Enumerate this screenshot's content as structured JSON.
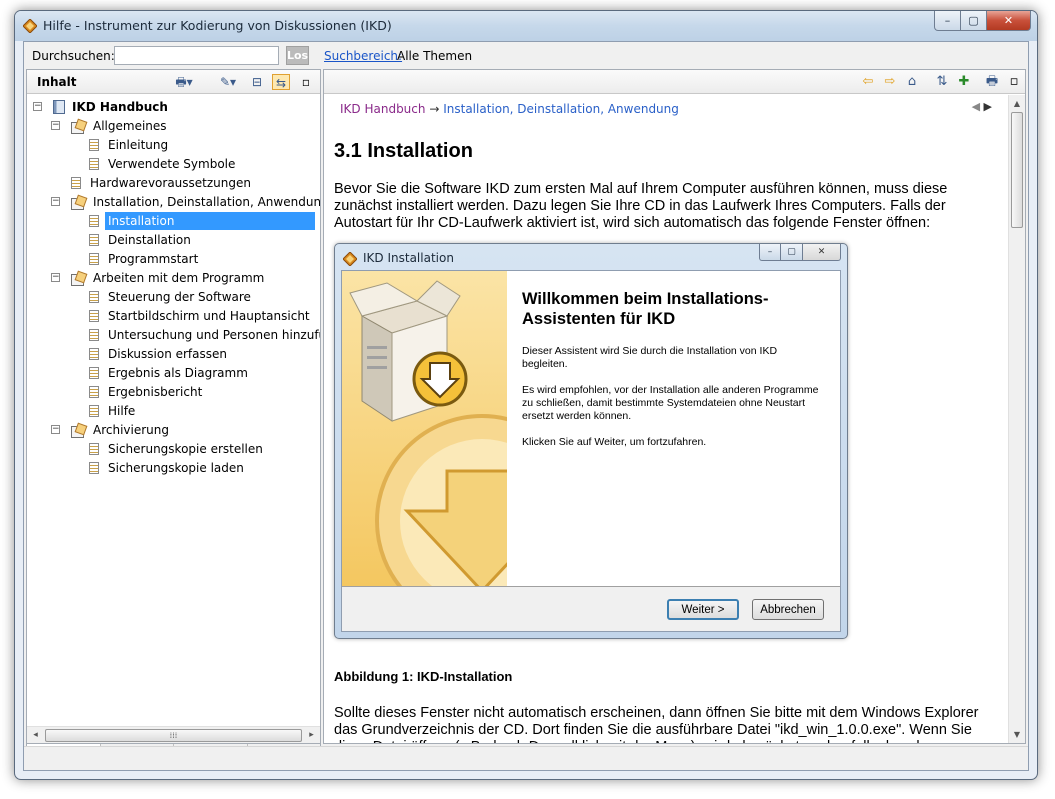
{
  "window": {
    "title": "Hilfe - Instrument zur Kodierung von Diskussionen (IKD)",
    "controls": {
      "minimize": "–",
      "maximize": "▢",
      "close": "✕"
    }
  },
  "search": {
    "label": "Durchsuchen:",
    "value": "",
    "go_label": "Los",
    "scope_link": "Suchbereich:",
    "scope_value": "Alle Themen"
  },
  "left_pane": {
    "title": "Inhalt",
    "toolbar_icons": [
      "print-icon",
      "settings-icon",
      "collapse-icon",
      "sync-icon",
      "restore-icon"
    ],
    "tree": [
      {
        "label": "IKD Handbuch",
        "level": 0,
        "icon": "book",
        "expander": "−",
        "bold": true
      },
      {
        "label": "Allgemeines",
        "level": 1,
        "icon": "folder-book",
        "expander": "−"
      },
      {
        "label": "Einleitung",
        "level": 2,
        "icon": "page"
      },
      {
        "label": "Verwendete Symbole",
        "level": 2,
        "icon": "page"
      },
      {
        "label": "Hardwarevoraussetzungen",
        "level": 1,
        "icon": "page"
      },
      {
        "label": "Installation, Deinstallation, Anwendung",
        "level": 1,
        "icon": "folder-book",
        "expander": "−"
      },
      {
        "label": "Installation",
        "level": 2,
        "icon": "page",
        "selected": true
      },
      {
        "label": "Deinstallation",
        "level": 2,
        "icon": "page"
      },
      {
        "label": "Programmstart",
        "level": 2,
        "icon": "page"
      },
      {
        "label": "Arbeiten mit dem Programm",
        "level": 1,
        "icon": "folder-book",
        "expander": "−"
      },
      {
        "label": "Steuerung der Software",
        "level": 2,
        "icon": "page"
      },
      {
        "label": "Startbildschirm und Hauptansicht",
        "level": 2,
        "icon": "page"
      },
      {
        "label": "Untersuchung und Personen hinzufügen",
        "level": 2,
        "icon": "page"
      },
      {
        "label": "Diskussion erfassen",
        "level": 2,
        "icon": "page"
      },
      {
        "label": "Ergebnis als Diagramm",
        "level": 2,
        "icon": "page"
      },
      {
        "label": "Ergebnisbericht",
        "level": 2,
        "icon": "page"
      },
      {
        "label": "Hilfe",
        "level": 2,
        "icon": "page"
      },
      {
        "label": "Archivierung",
        "level": 1,
        "icon": "folder-book",
        "expander": "−"
      },
      {
        "label": "Sicherungskopie erstellen",
        "level": 2,
        "icon": "page"
      },
      {
        "label": "Sicherungskopie laden",
        "level": 2,
        "icon": "page"
      }
    ],
    "bottom_tabs": [
      "contents-tab-icon",
      "index-tab-icon",
      "search-tab-icon",
      "favorites-tab-icon"
    ]
  },
  "right_pane": {
    "toolbar_icons": [
      "back-icon",
      "forward-icon",
      "home-icon",
      "sync-toc-icon",
      "add-bookmark-icon",
      "print-icon",
      "restore-icon"
    ],
    "breadcrumb": {
      "root": "IKD Handbuch",
      "separator": "→",
      "current": "Installation, Deinstallation, Anwendung"
    },
    "heading": "3.1 Installation",
    "paragraph1": "Bevor Sie die Software IKD zum ersten Mal auf Ihrem Computer ausführen können, muss diese zunächst installiert werden. Dazu legen Sie Ihre CD in das Laufwerk Ihres Computers. Falls der Autostart für Ihr CD-Laufwerk aktiviert ist, wird sich automatisch das folgende Fenster öffnen:",
    "figure": {
      "title": "IKD Installation",
      "heading": "Willkommen beim Installations-Assistenten für IKD",
      "text1": "Dieser Assistent wird Sie durch die Installation von IKD begleiten.",
      "text2": "Es wird empfohlen, vor der Installation alle anderen Programme zu schließen, damit bestimmte Systemdateien ohne Neustart ersetzt werden können.",
      "text3": "Klicken Sie auf Weiter, um fortzufahren.",
      "next_button": "Weiter >",
      "cancel_button": "Abbrechen"
    },
    "caption": "Abbildung 1: IKD-Installation",
    "paragraph2": "Sollte dieses Fenster nicht automatisch erscheinen, dann öffnen Sie bitte mit dem Windows Explorer das Grundverzeichnis der CD. Dort finden Sie die ausführbare Datei \"ikd_win_1.0.0.exe\". Wenn Sie diese Datei öffnen (z.B. durch Doppelklick mit der Maus), wird als nächstes ebenfalls das oben"
  },
  "colors": {
    "selection": "#3399ff",
    "link": "#1a55c8",
    "breadcrumb_root": "#8a2a8a",
    "breadcrumb_current": "#2a60c8",
    "banner": "#f4c760"
  }
}
